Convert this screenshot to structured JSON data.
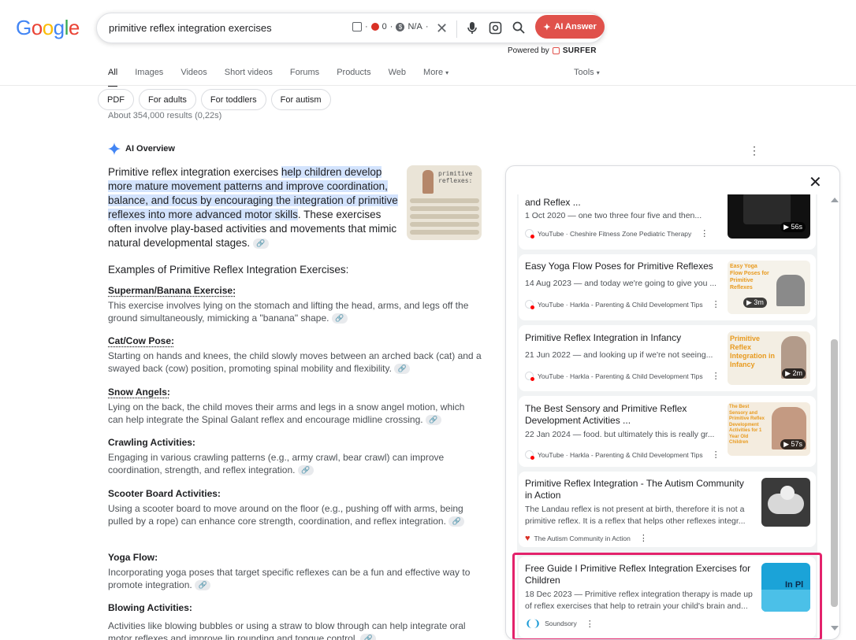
{
  "header": {
    "logo": "Google",
    "search_query": "primitive reflex integration exercises",
    "ext_count": "0",
    "ext_na": "N/A",
    "ai_button": "AI Answer",
    "powered_by": "Powered by",
    "powered_brand": "SURFER"
  },
  "tabs": [
    {
      "label": "All"
    },
    {
      "label": "Images"
    },
    {
      "label": "Videos"
    },
    {
      "label": "Short videos"
    },
    {
      "label": "Forums"
    },
    {
      "label": "Products"
    },
    {
      "label": "Web"
    },
    {
      "label": "More"
    }
  ],
  "tools_label": "Tools",
  "chips": [
    "PDF",
    "For adults",
    "For toddlers",
    "For autism"
  ],
  "result_stats": "About 354,000 results (0,22s)",
  "ai_overview": {
    "title": "AI Overview",
    "intro_pre": "Primitive reflex integration exercises ",
    "intro_hl": "help children develop more mature movement patterns and improve coordination, balance, and focus by encouraging the integration of primitive reflexes into more advanced motor skills",
    "intro_post": ". These exercises often involve play-based activities and movements that mimic natural developmental stages.",
    "thumb_text": "primitive reflexes:",
    "section_heading": "Examples of Primitive Reflex Integration Exercises:",
    "items": [
      {
        "title": "Superman/Banana Exercise:",
        "desc": "This exercise involves lying on the stomach and lifting the head, arms, and legs off the ground simultaneously, mimicking a \"banana\" shape."
      },
      {
        "title": "Cat/Cow Pose:",
        "desc": "Starting on hands and knees, the child slowly moves between an arched back (cat) and a swayed back (cow) position, promoting spinal mobility and flexibility."
      },
      {
        "title": "Snow Angels:",
        "desc": "Lying on the back, the child moves their arms and legs in a snow angel motion, which can help integrate the Spinal Galant reflex and encourage midline crossing."
      },
      {
        "title": "Crawling Activities:",
        "desc": "Engaging in various crawling patterns (e.g., army crawl, bear crawl) can improve coordination, strength, and reflex integration."
      },
      {
        "title": "Scooter Board Activities:",
        "desc": "Using a scooter board to move around on the floor (e.g., pushing off with arms, being pulled by a rope) can enhance core strength, coordination, and reflex integration."
      },
      {
        "title": "Yoga Flow:",
        "desc": "Incorporating yoga poses that target specific reflexes can be a fun and effective way to promote integration."
      },
      {
        "title": "Blowing Activities:",
        "desc": "Activities like blowing bubbles or using a straw to blow through can help integrate oral motor reflexes and improve lip rounding and tongue control."
      }
    ]
  },
  "side_panel": {
    "cards": [
      {
        "title": "and Reflex ...",
        "snippet": "1 Oct 2020 — one two three four five and then...",
        "source": "YouTube · Cheshire Fitness Zone Pediatric Therapy",
        "duration": "56s"
      },
      {
        "title": "Easy Yoga Flow Poses for Primitive Reflexes",
        "snippet": "14 Aug 2023 — and today we're going to give you ...",
        "source": "YouTube · Harkla - Parenting & Child Development Tips",
        "duration": "3m",
        "thumb_text": "Easy Yoga Flow Poses for Primitive Reflexes"
      },
      {
        "title": "Primitive Reflex Integration in Infancy",
        "snippet": "21 Jun 2022 — and looking up if we're not seeing...",
        "source": "YouTube · Harkla - Parenting & Child Development Tips",
        "duration": "2m",
        "thumb_text": "Primitive Reflex Integration in Infancy"
      },
      {
        "title": "The Best Sensory and Primitive Reflex Development Activities ...",
        "snippet": "22 Jan 2024 — food. but ultimately this is really gr...",
        "source": "YouTube · Harkla - Parenting & Child Development Tips",
        "duration": "57s",
        "thumb_text": "The Best Sensory and Primitive Reflex Development Activities for 1 Year Old Children"
      },
      {
        "title": "Primitive Reflex Integration - The Autism Community in Action",
        "snippet1": "The Landau reflex is not present at birth, therefore it is not a",
        "snippet2": "primitive reflex. It is a reflex that helps other reflexes integr...",
        "source": "The Autism Community in Action"
      },
      {
        "title": "Free Guide I Primitive Reflex Integration Exercises for Children",
        "snippet1": "18 Dec 2023 — Primitive reflex integration therapy is made up",
        "snippet2": "of reflex exercises that help to retrain your child's brain and...",
        "source": "Soundsory",
        "thumb_text": "In Pl"
      }
    ]
  },
  "colors": {
    "accent_red": "#e0514b",
    "highlight": "#d3e3fd",
    "selection_box": "#e3226b"
  }
}
